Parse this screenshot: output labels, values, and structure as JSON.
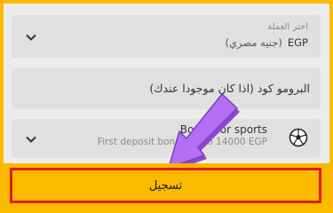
{
  "currency_field": {
    "label": "اختر العملة",
    "code": "EGP",
    "name": "(جنيه مصري)"
  },
  "promo_field": {
    "placeholder": "البرومو كود (اذا كان موجودا عندك)"
  },
  "bonus_field": {
    "title": "Bonus for sports",
    "subtitle": "First deposit bonus up to 14000 EGP"
  },
  "register_button": {
    "label": "تسجيل"
  },
  "icons": {
    "dropdown": "chevron-down-icon",
    "bonus": "soccer-ball-icon",
    "pointer": "arrow-pointer-icon"
  },
  "colors": {
    "frame": "#fbb900",
    "field_bg": "#e0e0e0",
    "button_border": "#e41b1b",
    "arrow": "#b36ef5"
  }
}
